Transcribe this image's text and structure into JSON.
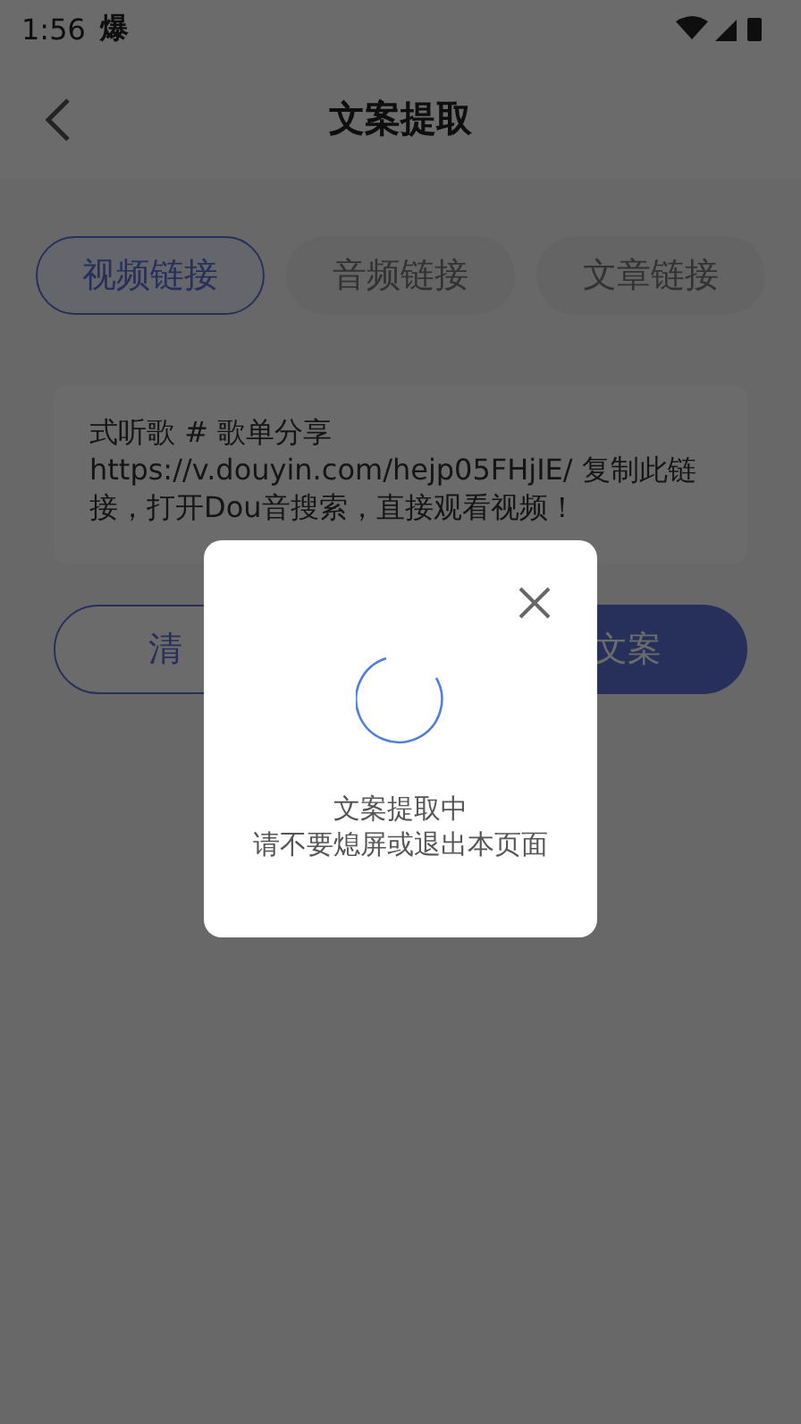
{
  "status_bar": {
    "time": "1:56",
    "app_glyph": "爆"
  },
  "header": {
    "title": "文案提取"
  },
  "tabs": [
    {
      "label": "视频链接",
      "selected": true
    },
    {
      "label": "音频链接",
      "selected": false
    },
    {
      "label": "文章链接",
      "selected": false
    }
  ],
  "input": {
    "value": "式听歌 # 歌单分享 https://v.douyin.com/hejp05FHjIE/ 复制此链接，打开Dou音搜索，直接观看视频！"
  },
  "buttons": [
    {
      "label": "清",
      "kind": "outline"
    },
    {
      "label": "文案",
      "kind": "filled"
    }
  ],
  "dialog": {
    "title": "文案提取中",
    "message": "请不要熄屏或退出本页面"
  }
}
